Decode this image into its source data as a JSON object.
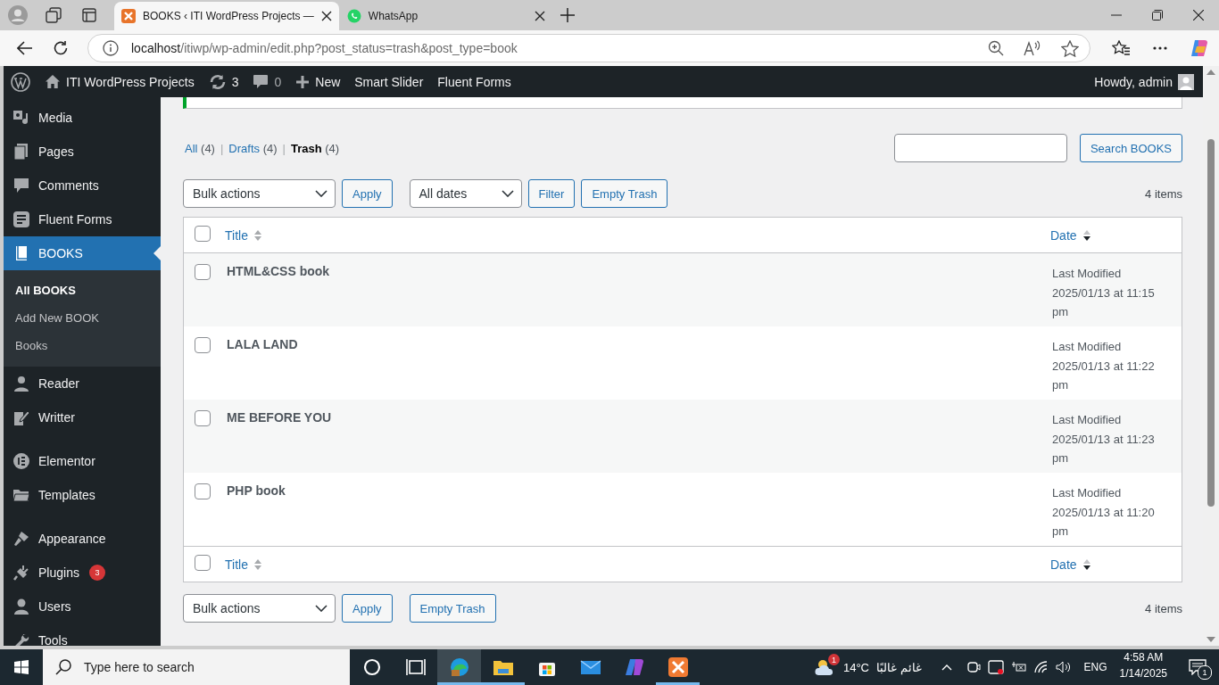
{
  "browser": {
    "tabs": [
      {
        "title": "BOOKS ‹ ITI WordPress Projects —",
        "selected": true
      },
      {
        "title": "WhatsApp",
        "selected": false
      }
    ],
    "url": {
      "host": "localhost",
      "path": "/itiwp/wp-admin/edit.php?post_status=trash&post_type=book"
    }
  },
  "admin_bar": {
    "site_name": "ITI WordPress Projects",
    "updates_count": "3",
    "comments_count": "0",
    "new_label": "New",
    "items": [
      "Smart Slider",
      "Fluent Forms"
    ],
    "greeting": "Howdy, admin"
  },
  "sidebar": {
    "groups": [
      {
        "items": [
          {
            "label": "Media",
            "selected": false
          },
          {
            "label": "Pages",
            "selected": false
          },
          {
            "label": "Comments",
            "selected": false
          },
          {
            "label": "Fluent Forms",
            "selected": false
          },
          {
            "label": "BOOKS",
            "selected": true,
            "children": [
              {
                "label": "All BOOKS",
                "selected": true
              },
              {
                "label": "Add New BOOK",
                "selected": false
              },
              {
                "label": "Books",
                "selected": false
              }
            ]
          },
          {
            "label": "Reader",
            "selected": false
          },
          {
            "label": "Writter",
            "selected": false
          }
        ]
      },
      {
        "items": [
          {
            "label": "Elementor",
            "selected": false
          },
          {
            "label": "Templates",
            "selected": false
          }
        ]
      },
      {
        "items": [
          {
            "label": "Appearance",
            "selected": false
          },
          {
            "label": "Plugins",
            "selected": false,
            "badge": "3"
          },
          {
            "label": "Users",
            "selected": false
          },
          {
            "label": "Tools",
            "selected": false
          }
        ]
      }
    ]
  },
  "views": [
    {
      "label": "All",
      "count": "(4)",
      "selected": false,
      "separator": "|"
    },
    {
      "label": "Drafts",
      "count": "(4)",
      "selected": false,
      "separator": "|"
    },
    {
      "label": "Trash",
      "count": "(4)",
      "selected": true
    }
  ],
  "search_button": "Search BOOKS",
  "top_nav": {
    "bulk_actions": "Bulk actions",
    "apply": "Apply",
    "dates": "All dates",
    "filter": "Filter",
    "empty_trash": "Empty Trash",
    "count": "4 items"
  },
  "table": {
    "header_checkbox": {
      "checked": false
    },
    "columns": [
      {
        "label": "Title",
        "sorted": false
      },
      {
        "label": "Date",
        "sorted": true
      }
    ],
    "rows": [
      {
        "title": "HTML&CSS book",
        "date_label": "Last Modified",
        "date": "2025/01/13 at 11:15 pm",
        "checked": false
      },
      {
        "title": "LALA LAND",
        "date_label": "Last Modified",
        "date": "2025/01/13 at 11:22 pm",
        "checked": false
      },
      {
        "title": "ME BEFORE YOU",
        "date_label": "Last Modified",
        "date": "2025/01/13 at 11:23 pm",
        "checked": false
      },
      {
        "title": "PHP book",
        "date_label": "Last Modified",
        "date": "2025/01/13 at 11:20 pm",
        "checked": false
      }
    ],
    "footer_checkbox": {
      "checked": false
    },
    "footer_columns": [
      {
        "label": "Title",
        "sorted": false
      },
      {
        "label": "Date",
        "sorted": true
      }
    ]
  },
  "bottom_nav": {
    "bulk_actions": "Bulk actions",
    "apply": "Apply",
    "empty_trash": "Empty Trash",
    "count": "4 items"
  },
  "taskbar": {
    "search_placeholder": "Type here to search",
    "apps": [
      {
        "active": false,
        "running": false
      },
      {
        "active": false,
        "running": false
      },
      {
        "active": true,
        "running": true
      },
      {
        "active": false,
        "running": true
      },
      {
        "active": false,
        "running": false
      },
      {
        "active": false,
        "running": false
      },
      {
        "active": false,
        "running": false
      },
      {
        "active": false,
        "running": true
      }
    ],
    "weather_badge": "1",
    "temperature": "14°C",
    "weather_text": "غائم غالبًا",
    "language": "ENG",
    "time": "4:58 AM",
    "date": "1/14/2025",
    "notification_count": "1"
  }
}
